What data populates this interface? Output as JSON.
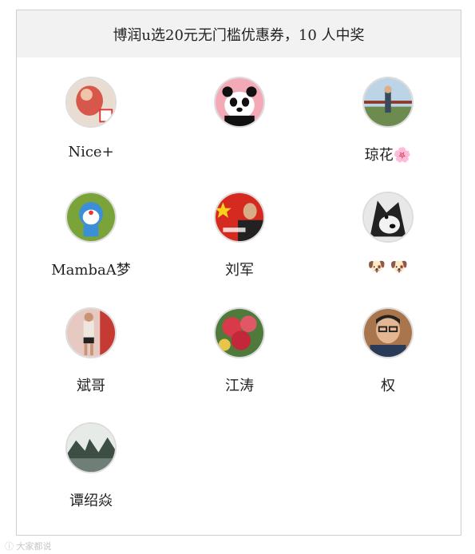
{
  "header": {
    "title": "博润u选20元无门槛优惠券，10 人中奖"
  },
  "winners": [
    {
      "name": "Nice+",
      "avatar": "red-mascot-avatar"
    },
    {
      "name": "",
      "avatar": "panda-avatar"
    },
    {
      "name": "琼花🌸",
      "avatar": "person-railing-avatar"
    },
    {
      "name": "MambaA梦",
      "avatar": "doraemon-avatar"
    },
    {
      "name": "刘军",
      "avatar": "man-flag-avatar"
    },
    {
      "name": "🐶 🐶",
      "avatar": "husky-avatar"
    },
    {
      "name": "斌哥",
      "avatar": "runner-avatar"
    },
    {
      "name": "江涛",
      "avatar": "peony-avatar"
    },
    {
      "name": "权",
      "avatar": "young-man-avatar"
    },
    {
      "name": "谭绍焱",
      "avatar": "landscape-avatar"
    }
  ],
  "watermark": "ⓘ 大家都说"
}
